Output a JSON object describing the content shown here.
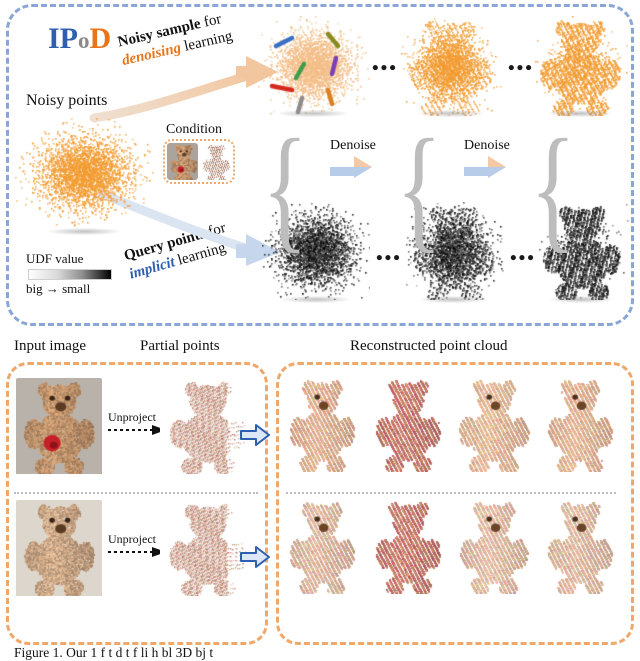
{
  "figure": {
    "caption": "Figure 1. Our 1 f  t   d  t  f   li h bl  3D bj t"
  },
  "top_panel": {
    "logo": {
      "part1": "IP",
      "part2": "o",
      "part3": "D"
    },
    "labels": {
      "noisy_points": "Noisy points",
      "condition": "Condition",
      "noisy_sample_line1_bold": "Noisy sample",
      "noisy_sample_line1_plain": " for",
      "noisy_sample_line2_accent": "denoising",
      "noisy_sample_line2_plain": " learning",
      "query_points_line1_bold": "Query points",
      "query_points_line1_plain": " for",
      "query_points_line2_accent": "implicit",
      "query_points_line2_plain": " learning"
    },
    "udf_legend": {
      "title": "UDF value",
      "scale": "big → small",
      "gradient_from": "#ffffff",
      "gradient_to": "#000000"
    },
    "denoise_steps": [
      {
        "label": "Denoise"
      },
      {
        "label": "Denoise"
      }
    ],
    "ellipsis": "•••",
    "colors": {
      "panel_border": "#8aa6d6",
      "accent_orange": "#e8751a",
      "accent_blue": "#2f5fb0",
      "point_orange": "#f29b30",
      "point_orange_light": "#f5c08a",
      "arrow_top": "#f5c9a4",
      "arrow_bottom": "#b7cce8"
    }
  },
  "bottom_panel": {
    "headers": {
      "input_image": "Input image",
      "partial_points": "Partial points",
      "reconstructed": "Reconstructed point cloud"
    },
    "rows": [
      {
        "unproject_label": "Unproject"
      },
      {
        "unproject_label": "Unproject"
      }
    ],
    "colors": {
      "panel_border": "#f0a86a",
      "blue_arrow_stroke": "#2f5fb0",
      "blue_arrow_fill": "#dce7f7"
    }
  }
}
